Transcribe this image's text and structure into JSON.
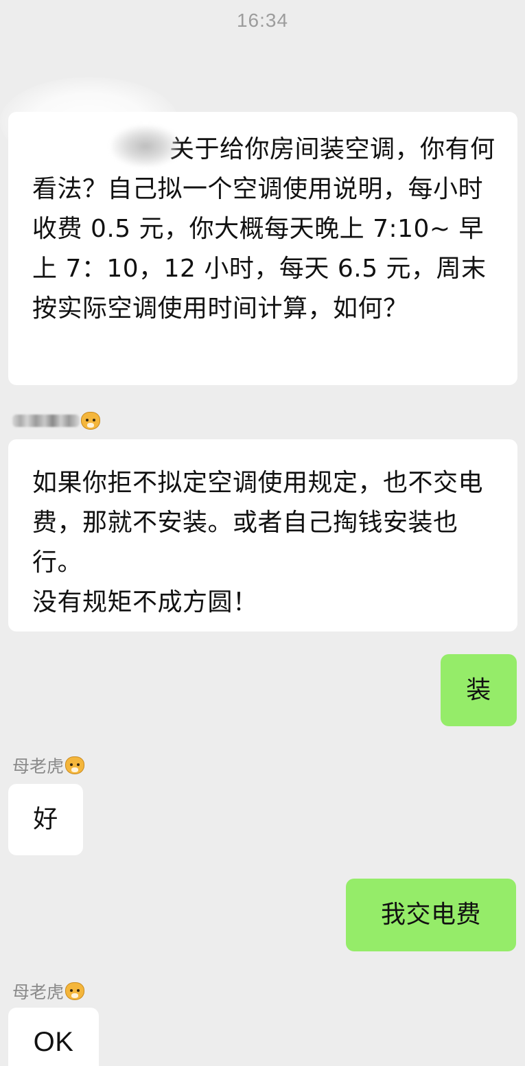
{
  "timestamp": "16:34",
  "messages": [
    {
      "direction": "incoming",
      "text": "关于给你房间装空调，你有何看法？自己拟一个空调使用说明，每小时收费 0.5 元，你大概每天晚上 7:10~ 早上 7：10，12 小时，每天 6.5 元，周末按实际空调使用时间计算，如何？"
    },
    {
      "direction": "incoming",
      "sender_emoji": "tiger-icon",
      "text": "如果你拒不拟定空调使用规定，也不交电费，那就不安装。或者自己掏钱安装也行。\n没有规矩不成方圆！"
    },
    {
      "direction": "outgoing",
      "text": "装"
    },
    {
      "direction": "incoming",
      "sender_name": "母老虎",
      "sender_emoji": "tiger-icon",
      "text": "好"
    },
    {
      "direction": "outgoing",
      "text": "我交电费"
    },
    {
      "direction": "incoming",
      "sender_name": "母老虎",
      "sender_emoji": "tiger-icon",
      "text": "OK"
    }
  ],
  "colors": {
    "background": "#ededed",
    "incoming_bubble": "#ffffff",
    "outgoing_bubble": "#95ec69",
    "timestamp_text": "#9c9c9c",
    "sender_text": "#8a8a8a"
  }
}
